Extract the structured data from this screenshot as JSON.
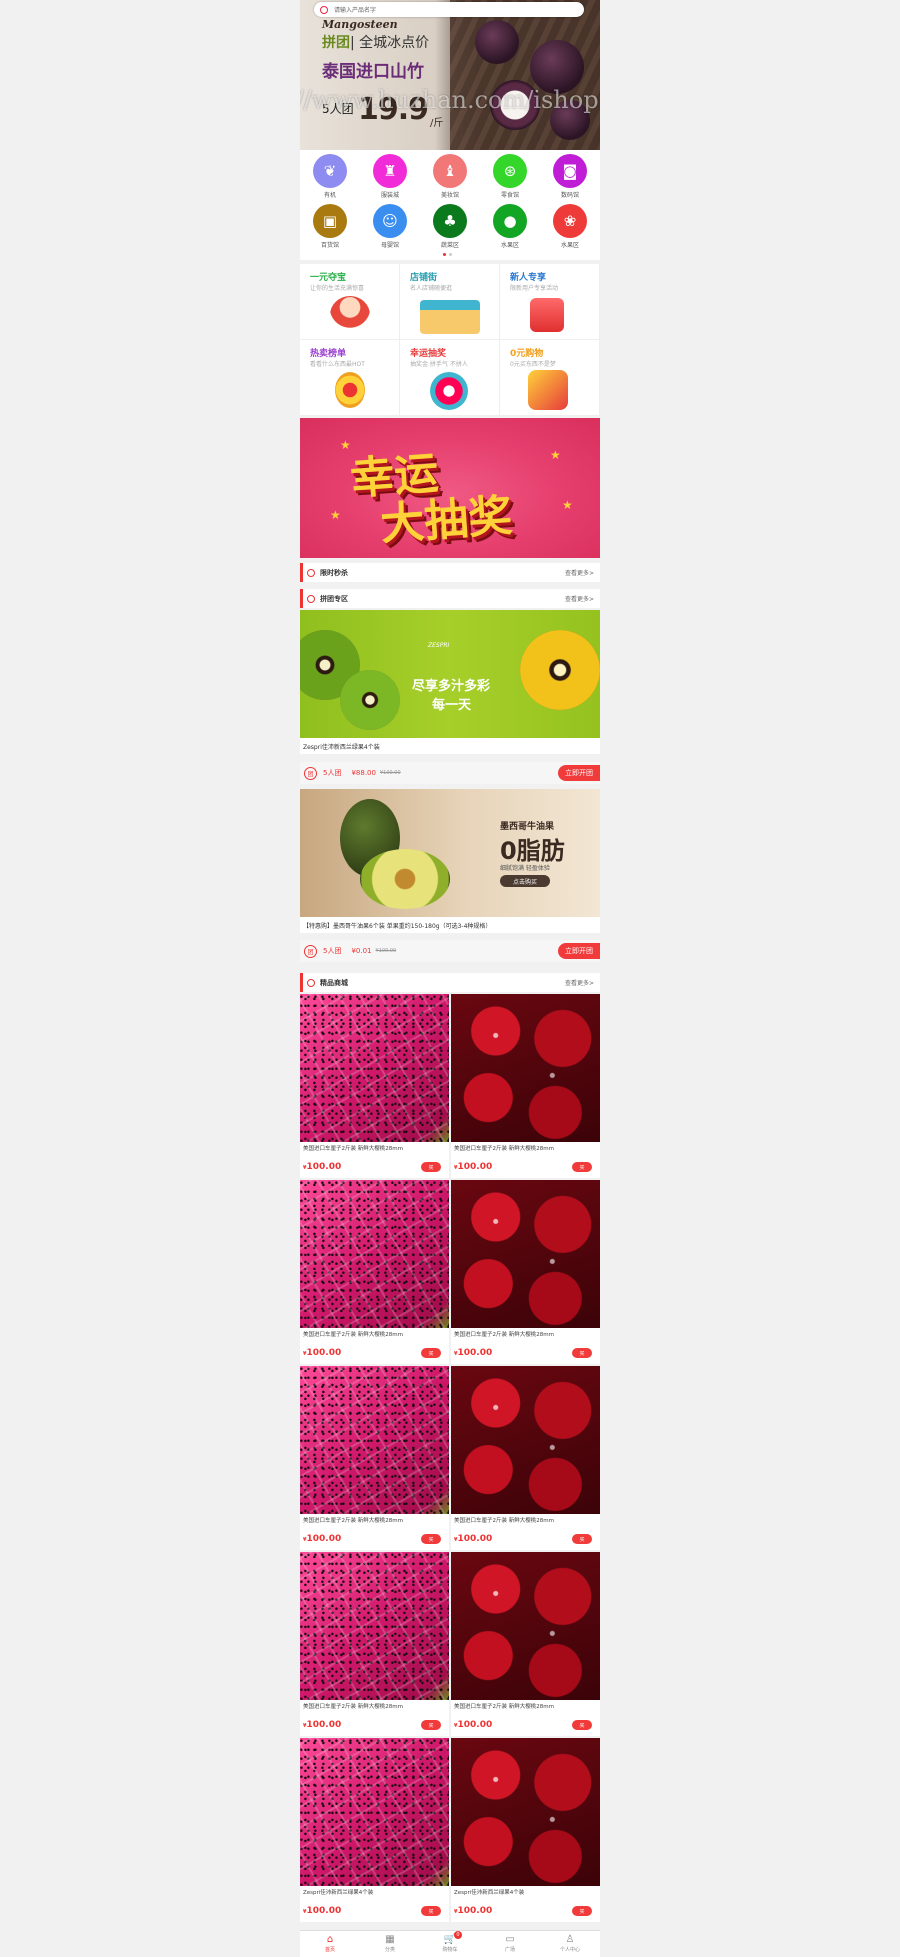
{
  "search": {
    "placeholder": "请输入产品名字"
  },
  "hero": {
    "brand": "Mangosteen",
    "line1_a": "拼团",
    "line1_b": "| 全城冰点价",
    "line2": "泰国进口山竹",
    "group": "5人团",
    "price": "19.9",
    "unit": "/斤"
  },
  "watermark": "https://www.huzhan.com/ishop15931",
  "categories": [
    {
      "label": "有机",
      "color": "#8e8cf0",
      "icon": "leaf-icon"
    },
    {
      "label": "服装城",
      "color": "#f12bd8",
      "icon": "shirt-icon"
    },
    {
      "label": "美妆馆",
      "color": "#f27777",
      "icon": "bottle-icon"
    },
    {
      "label": "零食馆",
      "color": "#34d62a",
      "icon": "lollipop-icon"
    },
    {
      "label": "数码馆",
      "color": "#c01ed6",
      "icon": "camera-icon"
    },
    {
      "label": "百货馆",
      "color": "#a97a10",
      "icon": "bag-icon"
    },
    {
      "label": "母婴馆",
      "color": "#3a8ef0",
      "icon": "baby-icon"
    },
    {
      "label": "蔬菜区",
      "color": "#0b7a1d",
      "icon": "broccoli-icon"
    },
    {
      "label": "水果区",
      "color": "#13a524",
      "icon": "apple-icon"
    },
    {
      "label": "水果区",
      "color": "#ef3a3a",
      "icon": "cherry-icon"
    }
  ],
  "promos": [
    {
      "title": "一元夺宝",
      "sub": "让你的生活充满惊喜",
      "color": "#2bb04a"
    },
    {
      "title": "店铺街",
      "sub": "名人店铺随便逛",
      "color": "#2b9fb0"
    },
    {
      "title": "新人专享",
      "sub": "限新用户专享活动",
      "color": "#2b7ad1"
    },
    {
      "title": "热卖榜单",
      "sub": "看看什么东西最HOT",
      "color": "#9a3fd0"
    },
    {
      "title": "幸运抽奖",
      "sub": "抽奖金 拼手气 不拼人",
      "color": "#e63b3b"
    },
    {
      "title": "0元购物",
      "sub": "0元买东西不是梦",
      "color": "#f0a020"
    }
  ],
  "lottery": {
    "line1": "幸运",
    "line2": "大抽奖"
  },
  "sections": {
    "flash": {
      "title": "限时秒杀",
      "more": "查看更多>"
    },
    "group": {
      "title": "拼团专区",
      "more": "查看更多>"
    },
    "featured": {
      "title": "精品商城",
      "more": "查看更多>"
    }
  },
  "deals": [
    {
      "banner_brand": "ZESPRI",
      "banner_text1": "尽享多汁多彩",
      "banner_text2": "每一天",
      "title": "Zespri佳沛新西兰绿果4个装",
      "group": "5人团",
      "price": "¥88.00",
      "old": "¥100.00",
      "button": "立即开团"
    },
    {
      "banner_text0": "墨西哥牛油果",
      "banner_text1": "0脂肪",
      "banner_text2": "细腻饱满  轻盈体验",
      "banner_btn": "点击购买",
      "title": "【特惠购】墨西哥牛油果6个装 单果重约150-180g（可选3-4种规格）",
      "group": "5人团",
      "price": "¥0.01",
      "old": "¥100.00",
      "button": "立即开团"
    }
  ],
  "products": [
    {
      "name": "美国进口车厘子2斤装 新鲜大樱桃28mm",
      "price": "100.00",
      "img": "dragon",
      "buy": "买"
    },
    {
      "name": "美国进口车厘子2斤装 新鲜大樱桃28mm",
      "price": "100.00",
      "img": "cherry",
      "buy": "买"
    },
    {
      "name": "美国进口车厘子2斤装 新鲜大樱桃28mm",
      "price": "100.00",
      "img": "dragon",
      "buy": "买"
    },
    {
      "name": "美国进口车厘子2斤装 新鲜大樱桃28mm",
      "price": "100.00",
      "img": "cherry",
      "buy": "买"
    },
    {
      "name": "美国进口车厘子2斤装 新鲜大樱桃28mm",
      "price": "100.00",
      "img": "dragon",
      "buy": "买"
    },
    {
      "name": "美国进口车厘子2斤装 新鲜大樱桃28mm",
      "price": "100.00",
      "img": "cherry",
      "buy": "买"
    },
    {
      "name": "美国进口车厘子2斤装 新鲜大樱桃28mm",
      "price": "100.00",
      "img": "dragon",
      "buy": "买"
    },
    {
      "name": "美国进口车厘子2斤装 新鲜大樱桃28mm",
      "price": "100.00",
      "img": "cherry",
      "buy": "买"
    },
    {
      "name": "Zespri佳沛新西兰绿果4个装",
      "price": "100.00",
      "img": "dragon",
      "buy": "买"
    },
    {
      "name": "Zespri佳沛新西兰绿果4个装",
      "price": "100.00",
      "img": "cherry",
      "buy": "买"
    }
  ],
  "currency": "¥",
  "tabbar": [
    {
      "label": "首页",
      "icon": "home-icon",
      "glyph": "⌂",
      "active": true
    },
    {
      "label": "分类",
      "icon": "grid-icon",
      "glyph": "▦",
      "active": false
    },
    {
      "label": "购物车",
      "icon": "cart-icon",
      "glyph": "🛒",
      "active": false,
      "badge": "0"
    },
    {
      "label": "广场",
      "icon": "square-icon",
      "glyph": "▭",
      "active": false
    },
    {
      "label": "个人中心",
      "icon": "user-icon",
      "glyph": "♙",
      "active": false
    }
  ]
}
